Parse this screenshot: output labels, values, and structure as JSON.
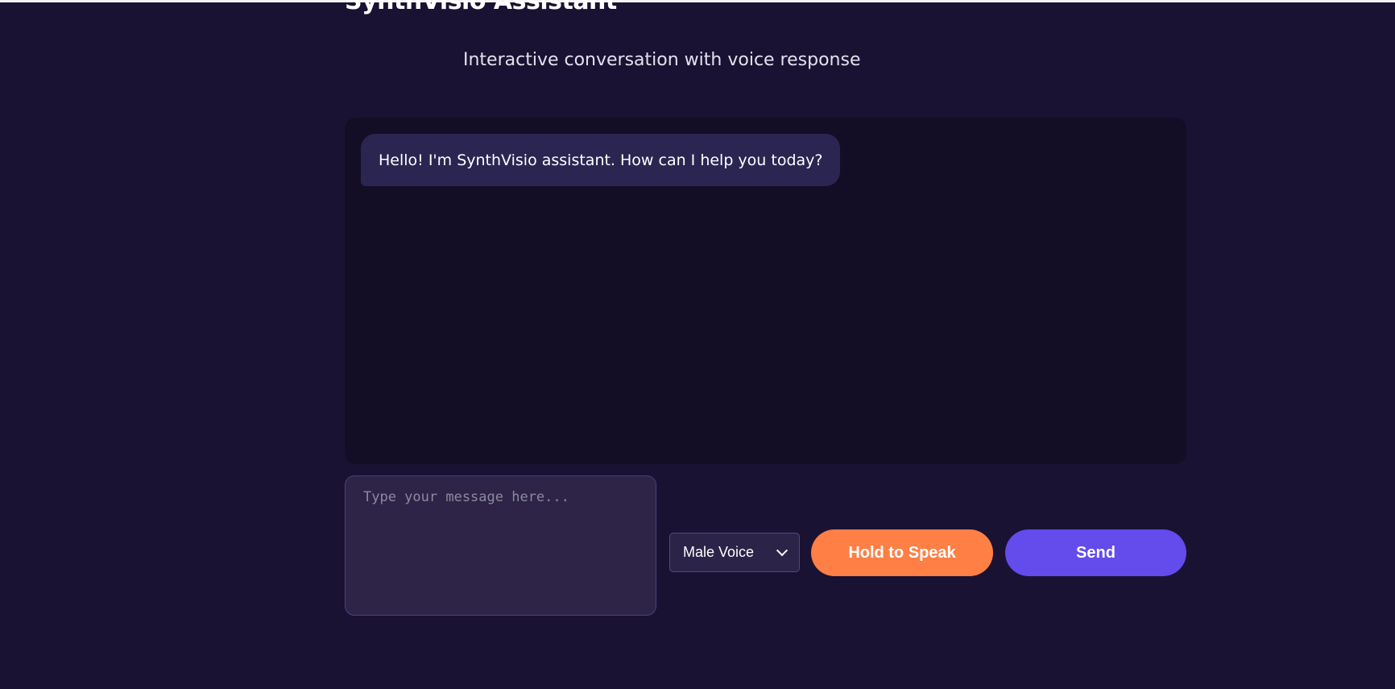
{
  "header": {
    "title": "SynthVisio Assistant",
    "subtitle": "Interactive conversation with voice response"
  },
  "chat": {
    "messages": [
      {
        "role": "assistant",
        "text": "Hello! I'm SynthVisio assistant. How can I help you today?"
      }
    ]
  },
  "composer": {
    "value": "",
    "placeholder": "Type your message here...",
    "voice_select": {
      "selected": "Male Voice"
    },
    "hold_to_speak_label": "Hold to Speak",
    "send_label": "Send"
  },
  "colors": {
    "background": "#1a1233",
    "chat_panel": "#130e25",
    "bubble": "#2b2552",
    "speak_button": "#ff7f45",
    "send_button": "#634bec"
  },
  "icons": {
    "voice_select_arrow": "chevron-down-icon"
  }
}
